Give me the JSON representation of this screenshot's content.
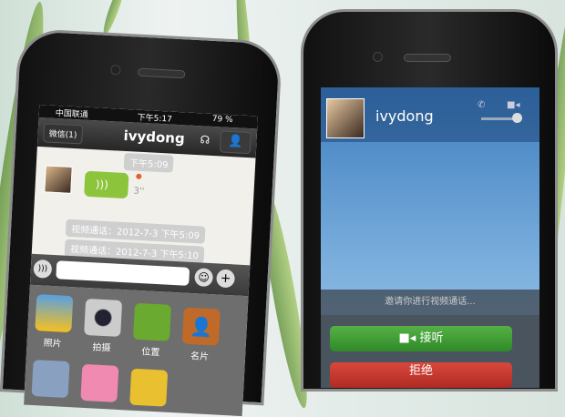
{
  "left_phone": {
    "status": {
      "carrier": "中国联通",
      "time": "下午5:17",
      "battery": "79 %"
    },
    "nav": {
      "back_label": "微信(1)",
      "title": "ivydong"
    },
    "messages": {
      "time_stamp": "下午5:09",
      "voice_duration": "3''",
      "call_logs": [
        "视频通话：2012-7-3 下午5:09",
        "视频通话：2012-7-3 下午5:10"
      ]
    },
    "apps": [
      {
        "label": "照片"
      },
      {
        "label": "拍摄"
      },
      {
        "label": "位置"
      },
      {
        "label": "名片"
      }
    ]
  },
  "right_phone": {
    "caller": "ivydong",
    "invite_text": "邀请你进行视频通话...",
    "accept_label": "接听",
    "decline_label": "拒绝"
  },
  "colors": {
    "accept": "#3f9b34",
    "decline": "#c9352c",
    "bubble": "#8cc43c"
  }
}
